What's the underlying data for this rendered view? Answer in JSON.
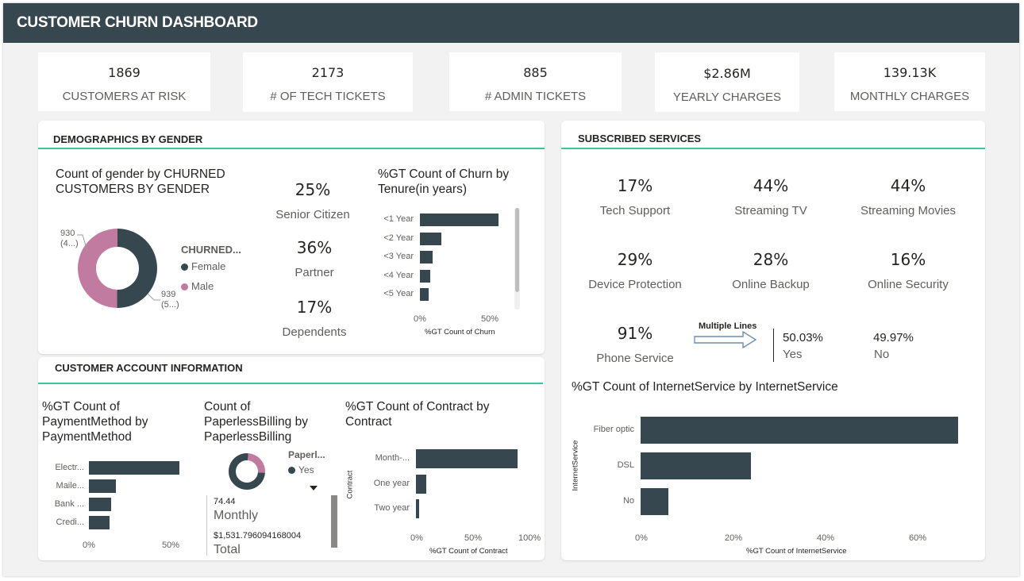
{
  "title": "CUSTOMER CHURN DASHBOARD",
  "kpis": [
    {
      "value": "1869",
      "label": "CUSTOMERS AT RISK"
    },
    {
      "value": "2173",
      "label": "# OF TECH TICKETS"
    },
    {
      "value": "885",
      "label": "# ADMIN TICKETS"
    },
    {
      "value": "$2.86M",
      "label": "YEARLY CHARGES"
    },
    {
      "value": "139.13K",
      "label": "MONTHLY CHARGES"
    }
  ],
  "demographics": {
    "title": "DEMOGRAPHICS BY GENDER",
    "gender_chart": {
      "title_line1": "Count of gender by CHURNED",
      "title_line2": "CUSTOMERS BY GENDER",
      "legend_title": "CHURNED...",
      "female_label": "Female",
      "male_label": "Male",
      "female_value": "939",
      "female_pct": "(5...)",
      "male_value": "930",
      "male_pct": "(4...)"
    },
    "stats": [
      {
        "value": "25%",
        "label": "Senior Citizen"
      },
      {
        "value": "36%",
        "label": "Partner"
      },
      {
        "value": "17%",
        "label": "Dependents"
      }
    ],
    "tenure_chart": {
      "title_line1": "%GT Count of Churn by",
      "title_line2": "Tenure(in years)",
      "xtick_0": "0%",
      "xtick_50": "50%",
      "xlabel": "%GT Count of Churn"
    }
  },
  "services": {
    "title": "SUBSCRIBED SERVICES",
    "stats": [
      {
        "value": "17%",
        "label": "Tech Support"
      },
      {
        "value": "44%",
        "label": "Streaming TV"
      },
      {
        "value": "44%",
        "label": "Streaming Movies"
      },
      {
        "value": "29%",
        "label": "Device Protection"
      },
      {
        "value": "28%",
        "label": "Online Backup"
      },
      {
        "value": "16%",
        "label": "Online Security"
      },
      {
        "value": "91%",
        "label": "Phone Service"
      }
    ],
    "multiple_lines": {
      "label": "Multiple Lines",
      "yes_value": "50.03%",
      "yes_label": "Yes",
      "no_value": "49.97%",
      "no_label": "No"
    },
    "internet_chart": {
      "title": "%GT Count of InternetService by InternetService",
      "ylabel": "InternetService",
      "xlabel": "%GT Count of InternetService",
      "xticks": [
        "0%",
        "20%",
        "40%",
        "60%"
      ]
    }
  },
  "account": {
    "title": "CUSTOMER ACCOUNT INFORMATION",
    "payment_chart": {
      "title_line1": "%GT Count of",
      "title_line2": "PaymentMethod by",
      "title_line3": "PaymentMethod",
      "xtick_0": "0%",
      "xtick_50": "50%"
    },
    "paperless": {
      "title_line1": "Count of",
      "title_line2": "PaperlessBilling by",
      "title_line3": "PaperlessBilling",
      "legend_title": "Paperl...",
      "legend_yes": "Yes",
      "monthly_value": "74.44",
      "monthly_label": "Monthly",
      "total_value": "$1,531.796094168004",
      "total_label": "Total"
    },
    "contract_chart": {
      "title_line1": "%GT Count of Contract by",
      "title_line2": "Contract",
      "ylabel": "Contract",
      "xlabel": "%GT Count of Contract",
      "xticks": [
        "0%",
        "50%",
        "100%"
      ]
    }
  },
  "colors": {
    "header": "#37474f",
    "bar": "#37474f",
    "female": "#37474f",
    "male": "#c27ba0",
    "accent_rule": "#3ec2a4"
  },
  "chart_data": [
    {
      "type": "pie",
      "title": "Count of gender by CHURNED CUSTOMERS BY GENDER",
      "legend_title": "CHURNED...",
      "categories": [
        "Female",
        "Male"
      ],
      "values": [
        939,
        930
      ],
      "legend": "right"
    },
    {
      "type": "bar",
      "title": "%GT Count of Churn by Tenure(in years)",
      "categories": [
        "<1 Year",
        "<2 Year",
        "<3 Year",
        "<4 Year",
        "<5 Year"
      ],
      "values": [
        55,
        15,
        9,
        7,
        6
      ],
      "xlabel": "%GT Count of Churn",
      "xlim": [
        0,
        60
      ]
    },
    {
      "type": "bar",
      "title": "%GT Count of PaymentMethod by PaymentMethod",
      "categories": [
        "Electr...",
        "Maile...",
        "Bank ...",
        "Credi..."
      ],
      "values": [
        57,
        17,
        14,
        13
      ],
      "xlim": [
        0,
        60
      ]
    },
    {
      "type": "pie",
      "title": "Count of PaperlessBilling by PaperlessBilling",
      "legend_title": "Paperl...",
      "categories": [
        "Yes",
        "No"
      ],
      "values": [
        75,
        25
      ]
    },
    {
      "type": "bar",
      "title": "%GT Count of Contract by Contract",
      "categories": [
        "Month-...",
        "One year",
        "Two year"
      ],
      "values": [
        89,
        9,
        3
      ],
      "xlabel": "%GT Count of Contract",
      "ylabel": "Contract",
      "xlim": [
        0,
        100
      ]
    },
    {
      "type": "bar",
      "title": "%GT Count of InternetService by InternetService",
      "categories": [
        "Fiber optic",
        "DSL",
        "No"
      ],
      "values": [
        69,
        24,
        6
      ],
      "xlabel": "%GT Count of InternetService",
      "ylabel": "InternetService",
      "xlim": [
        0,
        70
      ]
    }
  ]
}
